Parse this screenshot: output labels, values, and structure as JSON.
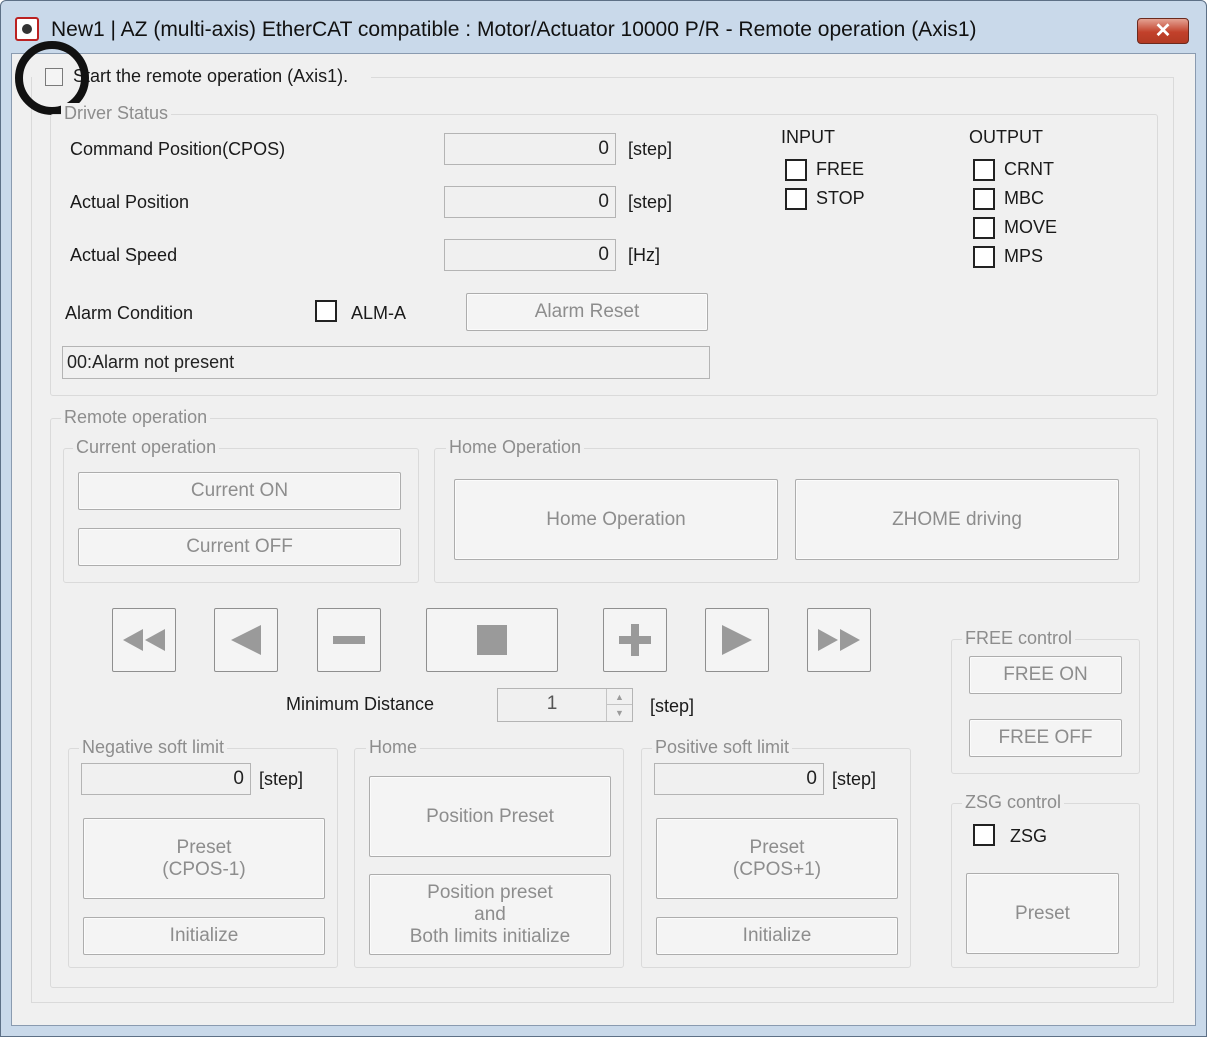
{
  "window": {
    "title": "New1 | AZ (multi-axis) EtherCAT compatible : Motor/Actuator 10000 P/R - Remote operation (Axis1)",
    "close_glyph": "✕"
  },
  "start_remote": {
    "label": "Start the remote operation (Axis1).",
    "checked": false
  },
  "driver_status": {
    "caption": "Driver Status",
    "cpos": {
      "label": "Command Position(CPOS)",
      "value": "0",
      "unit": "[step]"
    },
    "apos": {
      "label": "Actual Position",
      "value": "0",
      "unit": "[step]"
    },
    "aspeed": {
      "label": "Actual Speed",
      "value": "0",
      "unit": "[Hz]"
    },
    "alarm": {
      "label": "Alarm Condition",
      "alm_label": "ALM-A",
      "reset_label": "Alarm Reset",
      "message": "00:Alarm not present"
    },
    "input": {
      "caption": "INPUT",
      "items": [
        "FREE",
        "STOP"
      ]
    },
    "output": {
      "caption": "OUTPUT",
      "items": [
        "CRNT",
        "MBC",
        "MOVE",
        "MPS"
      ]
    }
  },
  "remote_operation": {
    "caption": "Remote operation",
    "current": {
      "caption": "Current operation",
      "on_label": "Current ON",
      "off_label": "Current OFF"
    },
    "home": {
      "caption": "Home Operation",
      "home_label": "Home Operation",
      "zhome_label": "ZHOME driving"
    },
    "min_distance": {
      "label": "Minimum Distance",
      "value": "1",
      "unit": "[step]"
    },
    "free_control": {
      "caption": "FREE control",
      "on_label": "FREE ON",
      "off_label": "FREE OFF"
    },
    "zsg_control": {
      "caption": "ZSG control",
      "zsg_label": "ZSG",
      "preset_label": "Preset"
    },
    "neg_limit": {
      "caption": "Negative soft limit",
      "value": "0",
      "unit": "[step]",
      "preset_line1": "Preset",
      "preset_line2": "(CPOS-1)",
      "init_label": "Initialize"
    },
    "home_group": {
      "caption": "Home",
      "preset_label": "Position Preset",
      "preset_both_line1": "Position preset",
      "preset_both_line2": "and",
      "preset_both_line3": "Both limits initialize"
    },
    "pos_limit": {
      "caption": "Positive soft limit",
      "value": "0",
      "unit": "[step]",
      "preset_line1": "Preset",
      "preset_line2": "(CPOS+1)",
      "init_label": "Initialize"
    }
  },
  "colors": {
    "frame": "#c9d9ea",
    "client": "#f0f0f0",
    "disabled_text": "#8d8d8d",
    "close": "#c2412b"
  }
}
